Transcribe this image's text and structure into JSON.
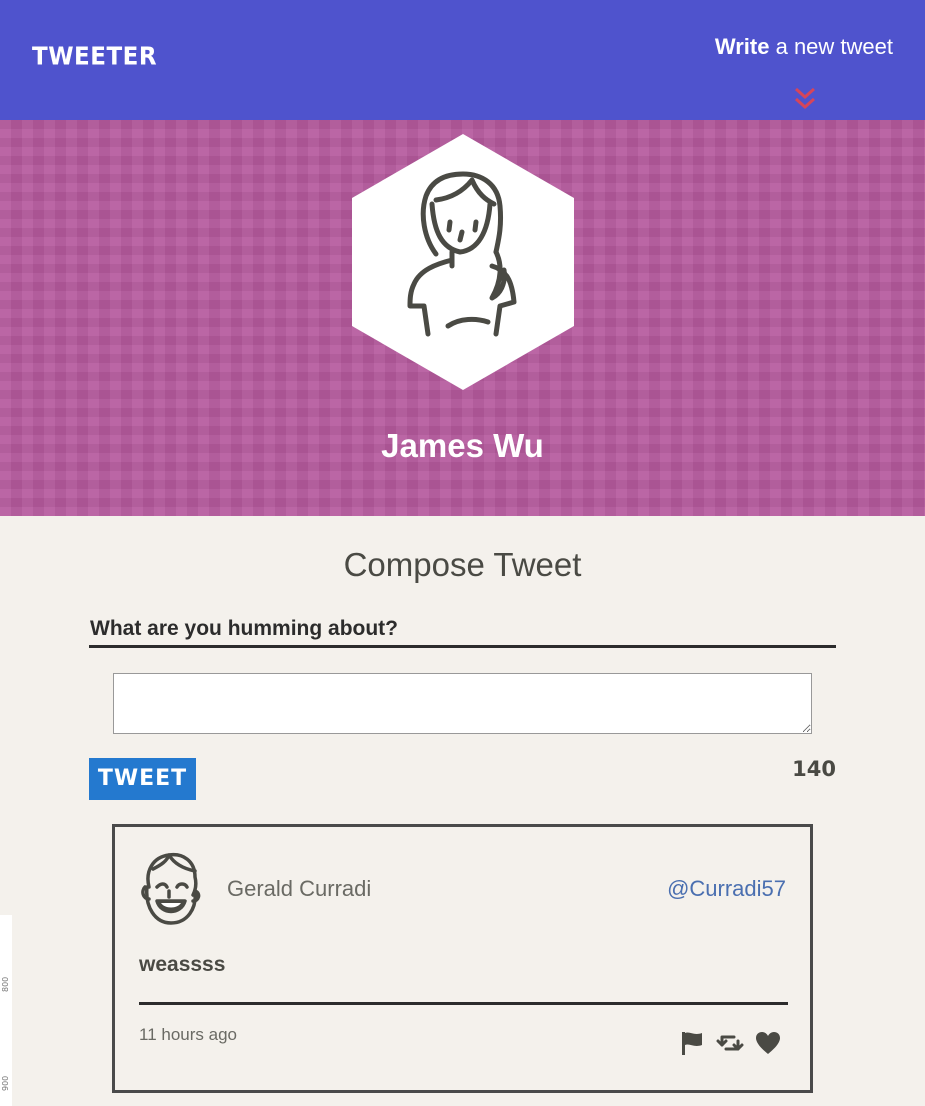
{
  "nav": {
    "brand": "TWEETER",
    "compose_bold": "Write",
    "compose_rest": " a new tweet"
  },
  "profile": {
    "name": "James Wu"
  },
  "compose": {
    "title": "Compose Tweet",
    "prompt": "What are you humming about?",
    "textarea_value": "",
    "button_label": "TWEET",
    "char_count": "140"
  },
  "tweets": [
    {
      "name": "Gerald Curradi",
      "handle": "@Curradi57",
      "content": "weassss",
      "time": "11 hours ago"
    }
  ],
  "ruler": {
    "mark_800": "800",
    "mark_900": "900"
  },
  "colors": {
    "nav_bg": "#4f53cd",
    "header_bg": "#b65b9e",
    "button_bg": "#2479cf",
    "handle": "#4a6fb0",
    "chevron": "#d6455a"
  }
}
